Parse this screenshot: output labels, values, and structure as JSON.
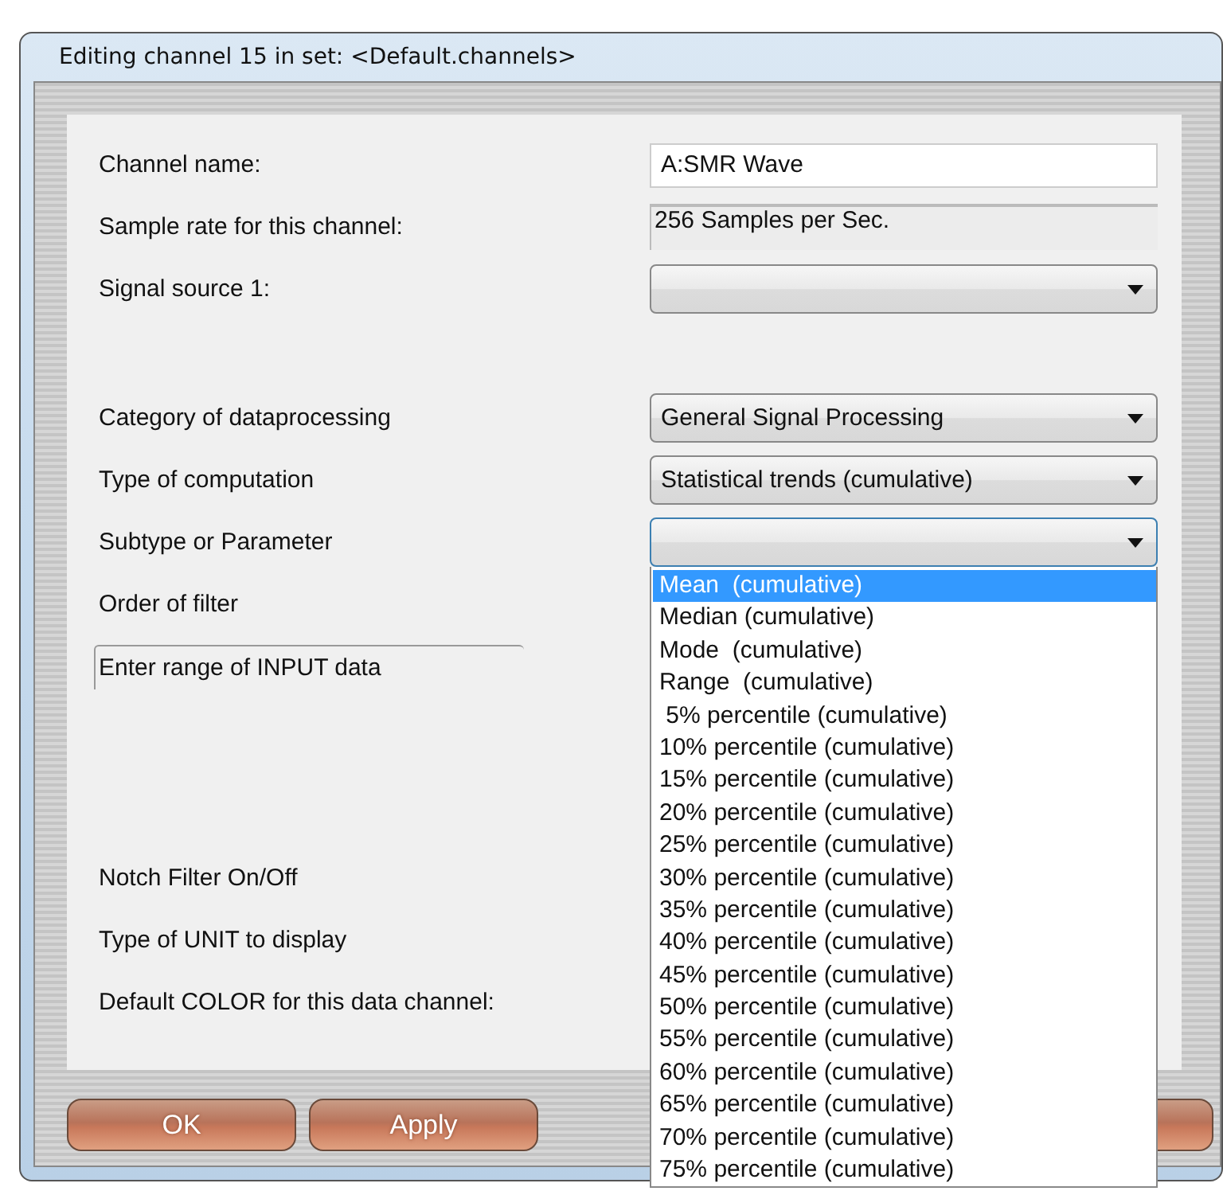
{
  "window": {
    "title": "Editing channel 15 in set: <Default.channels>"
  },
  "sections": [
    {
      "rows": [
        {
          "label": "Channel name:",
          "kind": "text",
          "value": "A:SMR Wave"
        },
        {
          "label": "Sample rate for this channel:",
          "kind": "readonly",
          "value": "256 Samples per Sec."
        },
        {
          "label": "Signal source 1:",
          "kind": "dropdown"
        }
      ]
    },
    {
      "rows": [
        {
          "label": "Category of dataprocessing",
          "kind": "dropdown",
          "value": "General Signal Processing"
        },
        {
          "label": "Type of computation",
          "kind": "dropdown",
          "value": "Statistical trends (cumulative)"
        },
        {
          "label": "Subtype or Parameter",
          "kind": "dropdown",
          "expanded": true,
          "options": [
            {
              "label": "Mean  (cumulative)",
              "selected": true
            },
            {
              "label": "Median (cumulative)",
              "selected": false
            },
            {
              "label": "Mode  (cumulative)",
              "selected": false
            },
            {
              "label": "Range  (cumulative)",
              "selected": false
            },
            {
              "label": " 5% percentile (cumulative)",
              "selected": false
            },
            {
              "label": "10% percentile (cumulative)",
              "selected": false
            },
            {
              "label": "15% percentile (cumulative)",
              "selected": false
            },
            {
              "label": "20% percentile (cumulative)",
              "selected": false
            },
            {
              "label": "25% percentile (cumulative)",
              "selected": false
            },
            {
              "label": "30% percentile (cumulative)",
              "selected": false
            },
            {
              "label": "35% percentile (cumulative)",
              "selected": false
            },
            {
              "label": "40% percentile (cumulative)",
              "selected": false
            },
            {
              "label": "45% percentile (cumulative)",
              "selected": false
            },
            {
              "label": "50% percentile (cumulative)",
              "selected": false
            },
            {
              "label": "55% percentile (cumulative)",
              "selected": false
            },
            {
              "label": "60% percentile (cumulative)",
              "selected": false
            },
            {
              "label": "65% percentile (cumulative)",
              "selected": false
            },
            {
              "label": "70% percentile (cumulative)",
              "selected": false
            },
            {
              "label": "75% percentile (cumulative)",
              "selected": false
            }
          ]
        },
        {
          "label": "Order of filter",
          "kind": "label"
        },
        {
          "label": "Enter range of INPUT data",
          "kind": "groupbox"
        }
      ]
    },
    {
      "rows": [
        {
          "label": "Notch Filter On/Off",
          "kind": "label"
        },
        {
          "label": "Type of UNIT to display",
          "kind": "label"
        },
        {
          "label": "Default COLOR for this data channel:",
          "kind": "label"
        }
      ]
    }
  ],
  "buttons": [
    "OK",
    "Apply"
  ]
}
